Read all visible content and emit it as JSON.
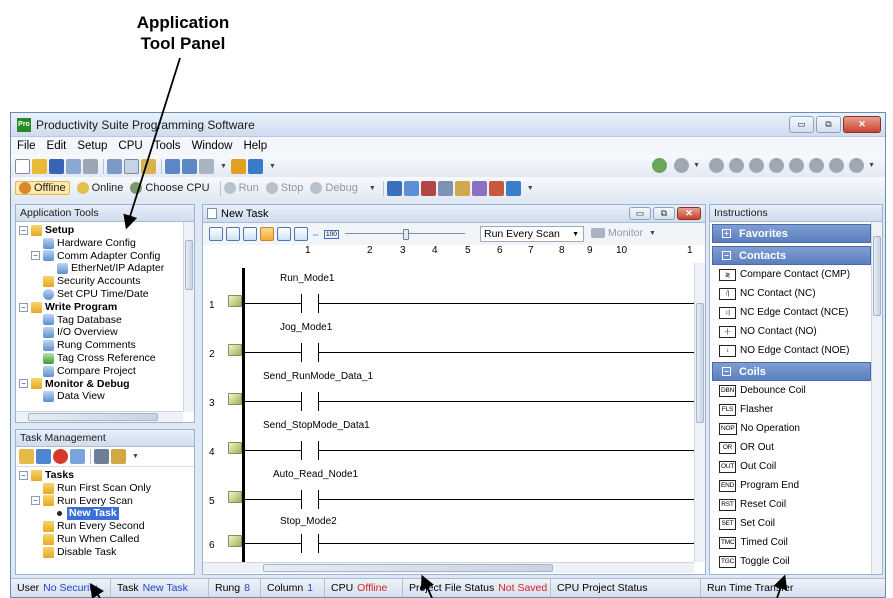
{
  "callouts": {
    "application_tool_panel": [
      "Application",
      "Tool Panel"
    ]
  },
  "window": {
    "title": "Productivity Suite Programming Software",
    "app_icon_text": "Pro",
    "minimize": "▭",
    "restore": "⧉",
    "close": "✕"
  },
  "menu": [
    "File",
    "Edit",
    "Setup",
    "CPU",
    "Tools",
    "Window",
    "Help"
  ],
  "toolbar2": {
    "offline": "Offline",
    "online": "Online",
    "choose_cpu": "Choose CPU",
    "run": "Run",
    "stop": "Stop",
    "debug": "Debug"
  },
  "app_tools": {
    "title": "Application Tools",
    "items": [
      {
        "label": "Setup",
        "bold": true
      },
      {
        "label": "Hardware Config"
      },
      {
        "label": "Comm Adapter Config"
      },
      {
        "label": "EtherNet/IP Adapter"
      },
      {
        "label": "Security Accounts"
      },
      {
        "label": "Set CPU Time/Date"
      },
      {
        "label": "Write Program",
        "bold": true
      },
      {
        "label": "Tag Database"
      },
      {
        "label": "I/O Overview"
      },
      {
        "label": "Rung Comments"
      },
      {
        "label": "Tag Cross Reference"
      },
      {
        "label": "Compare Project"
      },
      {
        "label": "Monitor & Debug",
        "bold": true
      },
      {
        "label": "Data View"
      }
    ]
  },
  "task_mgmt": {
    "title": "Task Management",
    "items": [
      {
        "label": "Tasks",
        "bold": true
      },
      {
        "label": "Run First Scan Only"
      },
      {
        "label": "Run Every Scan"
      },
      {
        "label": "New Task",
        "selected": true
      },
      {
        "label": "Run Every Second"
      },
      {
        "label": "Run When Called"
      },
      {
        "label": "Disable Task"
      }
    ]
  },
  "ladder": {
    "title": "New Task",
    "slider_value": "100",
    "scan_select": "Run Every Scan",
    "monitor": "Monitor",
    "columns": [
      "1",
      "2",
      "3",
      "4",
      "5",
      "6",
      "7",
      "8",
      "9",
      "10",
      "1"
    ],
    "rungs": [
      {
        "num": "1",
        "tag": "Run_Mode1"
      },
      {
        "num": "2",
        "tag": "Jog_Mode1"
      },
      {
        "num": "3",
        "tag": "Send_RunMode_Data_1"
      },
      {
        "num": "4",
        "tag": "Send_StopMode_Data1"
      },
      {
        "num": "5",
        "tag": "Auto_Read_Node1"
      },
      {
        "num": "6",
        "tag": "Stop_Mode2"
      }
    ]
  },
  "instructions": {
    "title": "Instructions",
    "favorites": "Favorites",
    "contacts_header": "Contacts",
    "contacts": [
      {
        "badge": "≷",
        "label": "Compare Contact (CMP)"
      },
      {
        "badge": "⧸|",
        "label": "NC Contact (NC)"
      },
      {
        "badge": "↕|",
        "label": "NC Edge Contact (NCE)"
      },
      {
        "badge": "-|-",
        "label": "NO Contact (NO)"
      },
      {
        "badge": "↕",
        "label": "NO Edge Contact (NOE)"
      }
    ],
    "coils_header": "Coils",
    "coils": [
      {
        "badge": "DBN",
        "label": "Debounce Coil"
      },
      {
        "badge": "FLS",
        "label": "Flasher"
      },
      {
        "badge": "NOP",
        "label": "No Operation"
      },
      {
        "badge": "OR",
        "label": "OR Out"
      },
      {
        "badge": "OUT",
        "label": "Out Coil"
      },
      {
        "badge": "END",
        "label": "Program End"
      },
      {
        "badge": "RST",
        "label": "Reset Coil"
      },
      {
        "badge": "SET",
        "label": "Set Coil"
      },
      {
        "badge": "TMC",
        "label": "Timed Coil"
      },
      {
        "badge": "TGC",
        "label": "Toggle Coil"
      }
    ]
  },
  "status": {
    "user_label": "User",
    "user_value": "No Security",
    "task_label": "Task",
    "task_value": "New Task",
    "rung_label": "Rung",
    "rung_value": "8",
    "column_label": "Column",
    "column_value": "1",
    "cpu_label": "CPU",
    "cpu_value": "Offline",
    "pfs_label": "Project File Status",
    "pfs_value": "Not Saved",
    "cps_label": "CPU Project Status",
    "rtt_label": "Run Time Transfer"
  },
  "colors": {
    "accent_blue": "#2442c8",
    "status_red": "#d42323",
    "instr_header": "#5a7fc0"
  }
}
